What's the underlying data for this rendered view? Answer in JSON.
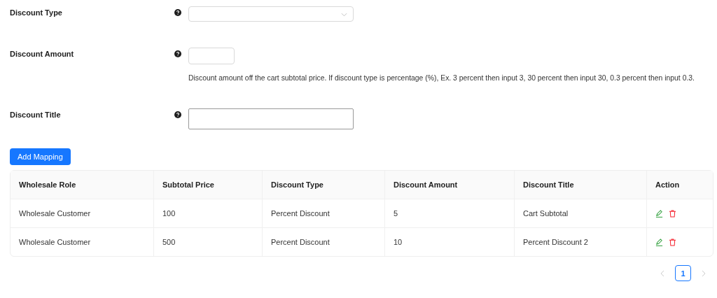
{
  "form": [
    {
      "label": "Discount Type",
      "kind": "select"
    },
    {
      "label": "Discount Amount",
      "kind": "short_input",
      "help_text": "Discount amount off the cart subtotal price. If discount type is percentage (%), Ex. 3 percent then input 3, 30 percent then input 30, 0.3 percent then input 0.3."
    },
    {
      "label": "Discount Title",
      "kind": "text_input"
    }
  ],
  "add_button": "Add Mapping",
  "table": {
    "columns": [
      "Wholesale Role",
      "Subtotal Price",
      "Discount Type",
      "Discount Amount",
      "Discount Title",
      "Action"
    ],
    "rows": [
      [
        "Wholesale Customer",
        "100",
        "Percent Discount",
        "5",
        "Cart Subtotal"
      ],
      [
        "Wholesale Customer",
        "500",
        "Percent Discount",
        "10",
        "Percent Discount 2"
      ]
    ]
  },
  "pagination": {
    "prev_disabled": true,
    "next_disabled": true,
    "pages": [
      {
        "label": "1",
        "selected": true
      }
    ]
  }
}
